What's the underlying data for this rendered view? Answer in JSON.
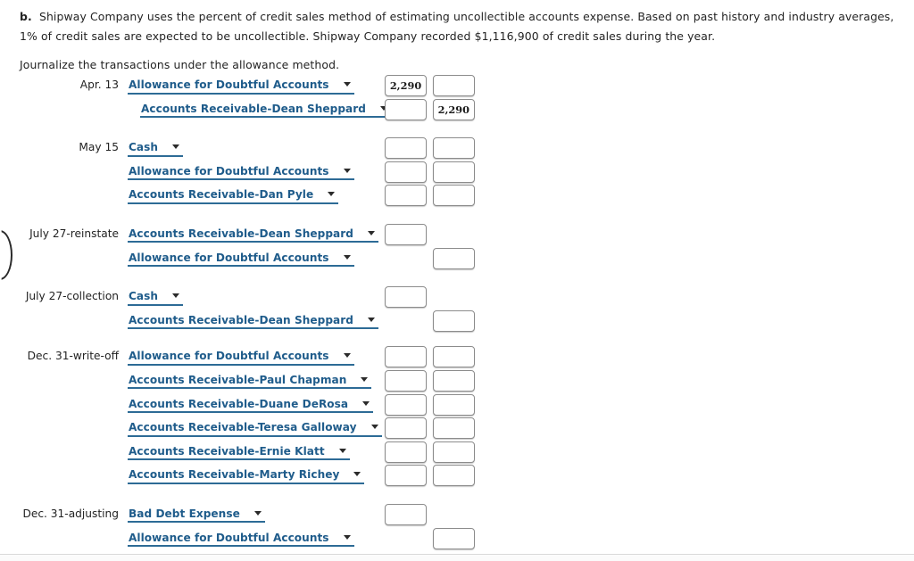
{
  "intro": {
    "marker": "b.",
    "paragraph": "Shipway Company uses the percent of credit sales method of estimating uncollectible accounts expense. Based on past history and industry averages, 1% of credit sales are expected to be uncollectible. Shipway Company recorded $1,116,900 of credit sales during the year.",
    "instruction": "Journalize the transactions under the allowance method."
  },
  "colors": {
    "link_blue": "#1f5c8b",
    "underline_blue": "#2d6b96",
    "box_border": "#8c8c8c",
    "text": "#232323"
  },
  "journal": {
    "blocks": [
      {
        "date": "Apr. 13",
        "rows": [
          {
            "account": "Allowance for Doubtful Accounts",
            "indent": false,
            "debit": "2,290",
            "credit": ""
          },
          {
            "account": "Accounts Receivable-Dean Sheppard",
            "indent": true,
            "debit": "",
            "credit": "2,290"
          }
        ]
      },
      {
        "date": "May 15",
        "rows": [
          {
            "account": "Cash",
            "indent": false,
            "debit": "",
            "credit": ""
          },
          {
            "account": "Allowance for Doubtful Accounts",
            "indent": false,
            "debit": "",
            "credit": ""
          },
          {
            "account": "Accounts Receivable-Dan Pyle",
            "indent": false,
            "debit": "",
            "credit": ""
          }
        ]
      },
      {
        "date": "July 27-reinstate",
        "rows": [
          {
            "account": "Accounts Receivable-Dean Sheppard",
            "indent": false,
            "debit": "",
            "credit": null
          },
          {
            "account": "Allowance for Doubtful Accounts",
            "indent": false,
            "debit": null,
            "credit": ""
          }
        ]
      },
      {
        "date": "July 27-collection",
        "rows": [
          {
            "account": "Cash",
            "indent": false,
            "debit": "",
            "credit": null
          },
          {
            "account": "Accounts Receivable-Dean Sheppard",
            "indent": false,
            "debit": null,
            "credit": ""
          }
        ]
      },
      {
        "date": "Dec. 31-write-off",
        "rows": [
          {
            "account": "Allowance for Doubtful Accounts",
            "indent": false,
            "debit": "",
            "credit": ""
          },
          {
            "account": "Accounts Receivable-Paul Chapman",
            "indent": false,
            "debit": "",
            "credit": ""
          },
          {
            "account": "Accounts Receivable-Duane DeRosa",
            "indent": false,
            "debit": "",
            "credit": ""
          },
          {
            "account": "Accounts Receivable-Teresa Galloway",
            "indent": false,
            "debit": "",
            "credit": ""
          },
          {
            "account": "Accounts Receivable-Ernie Klatt",
            "indent": false,
            "debit": "",
            "credit": ""
          },
          {
            "account": "Accounts Receivable-Marty Richey",
            "indent": false,
            "debit": "",
            "credit": ""
          }
        ]
      },
      {
        "date": "Dec. 31-adjusting",
        "rows": [
          {
            "account": "Bad Debt Expense",
            "indent": false,
            "debit": "",
            "credit": null
          },
          {
            "account": "Allowance for Doubtful Accounts",
            "indent": false,
            "debit": null,
            "credit": ""
          }
        ]
      }
    ]
  }
}
